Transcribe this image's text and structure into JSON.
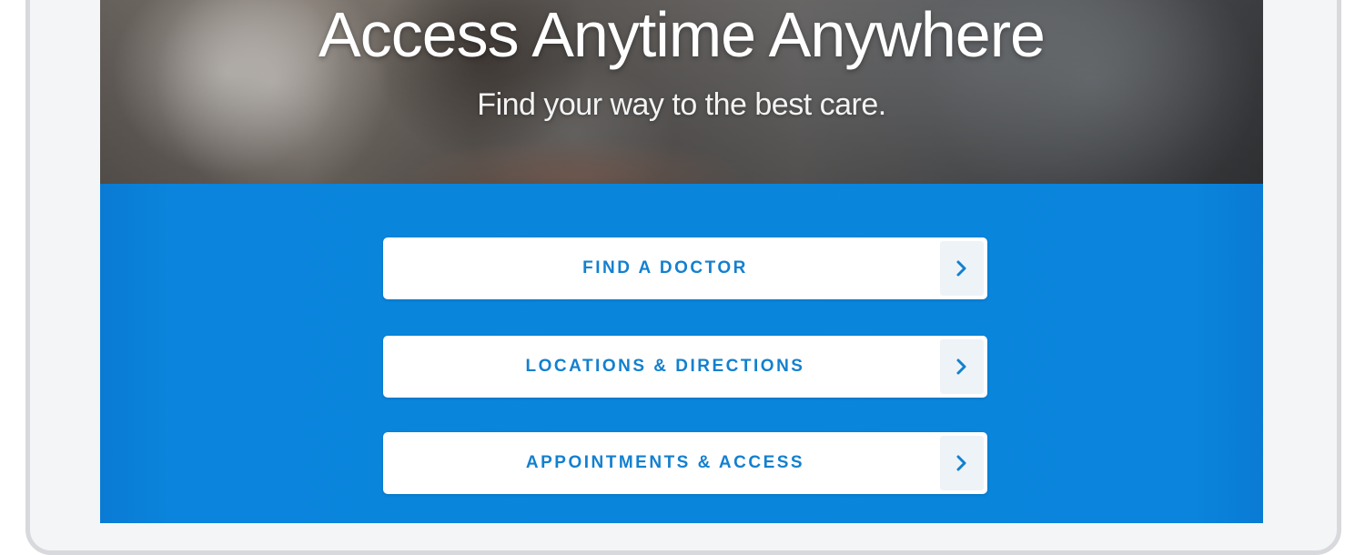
{
  "hero": {
    "title": "Access Anytime Anywhere",
    "subtitle": "Find your way to the best care."
  },
  "actions": [
    {
      "label": "FIND A DOCTOR",
      "icon": "chevron-right-icon"
    },
    {
      "label": "LOCATIONS & DIRECTIONS",
      "icon": "chevron-right-icon"
    },
    {
      "label": "APPOINTMENTS & ACCESS",
      "icon": "chevron-right-icon"
    }
  ],
  "colors": {
    "action_panel": "#0986dc",
    "button_text": "#1380cf",
    "button_bg": "#ffffff"
  }
}
